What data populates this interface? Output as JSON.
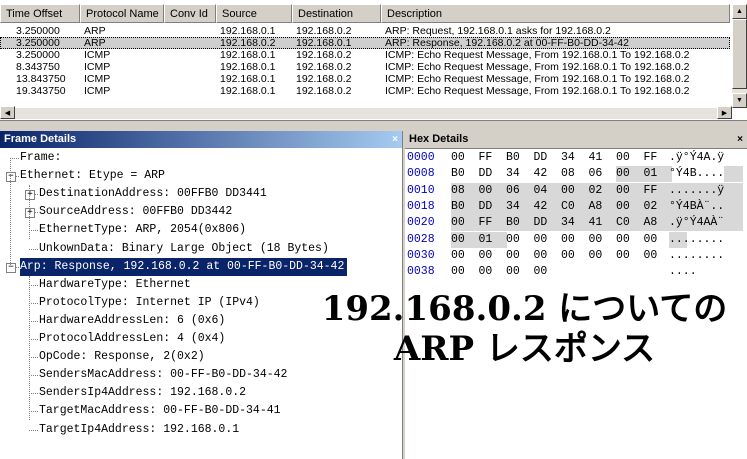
{
  "packet_list": {
    "columns": [
      "Time Offset",
      "Protocol Name",
      "Conv Id",
      "Source",
      "Destination",
      "Description"
    ],
    "rows": [
      [
        "3.250000",
        "ARP",
        "",
        "192.168.0.1",
        "192.168.0.2",
        "ARP: Request, 192.168.0.1 asks for 192.168.0.2"
      ],
      [
        "3.250000",
        "ARP",
        "",
        "192.168.0.2",
        "192.168.0.1",
        "ARP: Response, 192.168.0.2 at 00-FF-B0-DD-34-42"
      ],
      [
        "3.250000",
        "ICMP",
        "",
        "192.168.0.1",
        "192.168.0.2",
        "ICMP: Echo Request Message, From 192.168.0.1 To 192.168.0.2"
      ],
      [
        "8.343750",
        "ICMP",
        "",
        "192.168.0.1",
        "192.168.0.2",
        "ICMP: Echo Request Message, From 192.168.0.1 To 192.168.0.2"
      ],
      [
        "13.843750",
        "ICMP",
        "",
        "192.168.0.1",
        "192.168.0.2",
        "ICMP: Echo Request Message, From 192.168.0.1 To 192.168.0.2"
      ],
      [
        "19.343750",
        "ICMP",
        "",
        "192.168.0.1",
        "192.168.0.2",
        "ICMP: Echo Request Message, From 192.168.0.1 To 192.168.0.2"
      ]
    ],
    "selected_row": 1
  },
  "frame_details": {
    "title": "Frame Details",
    "close": "×",
    "nodes": [
      {
        "text": "Frame:",
        "level": 0,
        "toggle": ""
      },
      {
        "text": "Ethernet: Etype = ARP",
        "level": 0,
        "toggle": "-"
      },
      {
        "text": "DestinationAddress: 00FFB0 DD3441",
        "level": 1,
        "toggle": "+"
      },
      {
        "text": "SourceAddress: 00FFB0 DD3442",
        "level": 1,
        "toggle": "+"
      },
      {
        "text": "EthernetType: ARP, 2054(0x806)",
        "level": 1,
        "toggle": ""
      },
      {
        "text": "UnkownData: Binary Large Object (18 Bytes)",
        "level": 1,
        "toggle": ""
      },
      {
        "text": "Arp: Response, 192.168.0.2 at 00-FF-B0-DD-34-42",
        "level": 0,
        "toggle": "-",
        "selected": true
      },
      {
        "text": "HardwareType: Ethernet",
        "level": 1,
        "toggle": ""
      },
      {
        "text": "ProtocolType: Internet IP (IPv4)",
        "level": 1,
        "toggle": ""
      },
      {
        "text": "HardwareAddressLen: 6 (0x6)",
        "level": 1,
        "toggle": ""
      },
      {
        "text": "ProtocolAddressLen: 4 (0x4)",
        "level": 1,
        "toggle": ""
      },
      {
        "text": "OpCode: Response, 2(0x2)",
        "level": 1,
        "toggle": ""
      },
      {
        "text": "SendersMacAddress: 00-FF-B0-DD-34-42",
        "level": 1,
        "toggle": ""
      },
      {
        "text": "SendersIp4Address: 192.168.0.2",
        "level": 1,
        "toggle": ""
      },
      {
        "text": "TargetMacAddress: 00-FF-B0-DD-34-41",
        "level": 1,
        "toggle": ""
      },
      {
        "text": "TargetIp4Address: 192.168.0.1",
        "level": 1,
        "toggle": ""
      }
    ]
  },
  "hex_details": {
    "title": "Hex Details",
    "close": "×",
    "lines": [
      {
        "offset": "0000",
        "bytes": [
          "00",
          "FF",
          "B0",
          "DD",
          "34",
          "41",
          "00",
          "FF"
        ],
        "ascii": ".ÿ°Ý4A.ÿ",
        "hl": [
          false,
          false,
          false,
          false,
          false,
          false,
          false,
          false
        ]
      },
      {
        "offset": "0008",
        "bytes": [
          "B0",
          "DD",
          "34",
          "42",
          "08",
          "06",
          "00",
          "01"
        ],
        "ascii": "°Ý4B....",
        "hl": [
          false,
          false,
          false,
          false,
          false,
          false,
          true,
          true
        ]
      },
      {
        "offset": "0010",
        "bytes": [
          "08",
          "00",
          "06",
          "04",
          "00",
          "02",
          "00",
          "FF"
        ],
        "ascii": ".......ÿ",
        "hl": [
          true,
          true,
          true,
          true,
          true,
          true,
          true,
          true
        ]
      },
      {
        "offset": "0018",
        "bytes": [
          "B0",
          "DD",
          "34",
          "42",
          "C0",
          "A8",
          "00",
          "02"
        ],
        "ascii": "°Ý4BÀ¨..",
        "hl": [
          true,
          true,
          true,
          true,
          true,
          true,
          true,
          true
        ]
      },
      {
        "offset": "0020",
        "bytes": [
          "00",
          "FF",
          "B0",
          "DD",
          "34",
          "41",
          "C0",
          "A8"
        ],
        "ascii": ".ÿ°Ý4AÀ¨",
        "hl": [
          true,
          true,
          true,
          true,
          true,
          true,
          true,
          true
        ]
      },
      {
        "offset": "0028",
        "bytes": [
          "00",
          "01",
          "00",
          "00",
          "00",
          "00",
          "00",
          "00"
        ],
        "ascii": "........",
        "hl": [
          true,
          true,
          false,
          false,
          false,
          false,
          false,
          false
        ]
      },
      {
        "offset": "0030",
        "bytes": [
          "00",
          "00",
          "00",
          "00",
          "00",
          "00",
          "00",
          "00"
        ],
        "ascii": "........",
        "hl": [
          false,
          false,
          false,
          false,
          false,
          false,
          false,
          false
        ]
      },
      {
        "offset": "0038",
        "bytes": [
          "00",
          "00",
          "00",
          "00",
          "",
          "",
          "",
          ""
        ],
        "ascii": "....",
        "hl": [
          false,
          false,
          false,
          false,
          false,
          false,
          false,
          false
        ]
      }
    ]
  },
  "caption": {
    "line1": "192.168.0.2 についての",
    "line2": "ARP レスポンス"
  },
  "colors": {
    "title_bar": "#0a246a",
    "selection": "#0a246a",
    "hex_offset": "#0000c0",
    "hex_highlight": "#d8d8d8"
  }
}
